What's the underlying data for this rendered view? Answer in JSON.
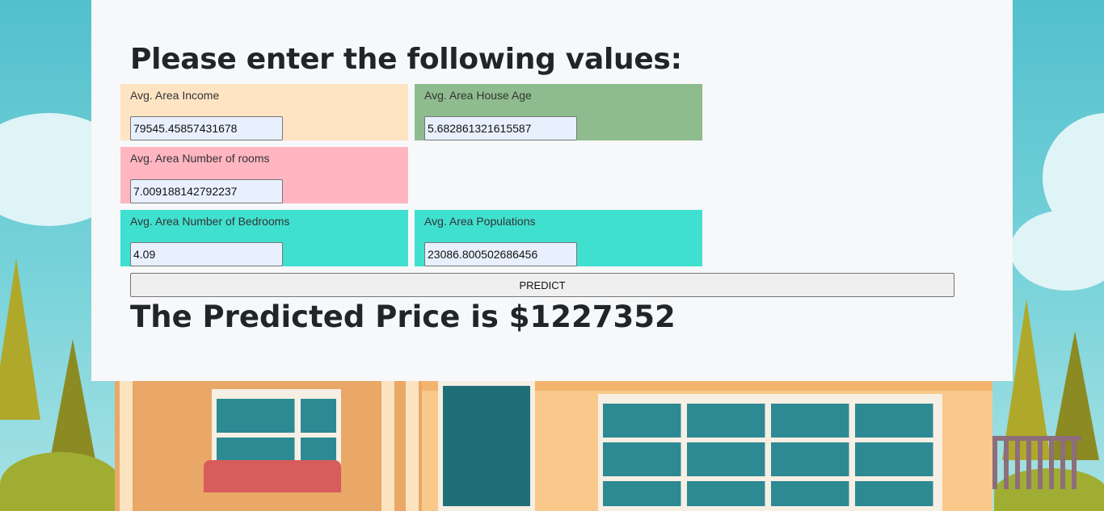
{
  "form": {
    "heading": "Please enter the following values:",
    "fields": [
      {
        "label": "Avg. Area Income",
        "value": "79545.45857431678",
        "color": "#ffe4c4"
      },
      {
        "label": "Avg. Area House Age",
        "value": "5.682861321615587",
        "color": "#8fbc8f"
      },
      {
        "label": "Avg. Area Number of rooms",
        "value": "7.009188142792237",
        "color": "#ffb6c1"
      },
      {
        "label": "Avg. Area Number of Bedrooms",
        "value": "4.09",
        "color": "#40e0d0"
      },
      {
        "label": "Avg. Area Populations",
        "value": "23086.800502686456",
        "color": "#40e0d0"
      }
    ],
    "predict_label": "PREDICT"
  },
  "result": {
    "text": "The Predicted Price is $1227352"
  }
}
